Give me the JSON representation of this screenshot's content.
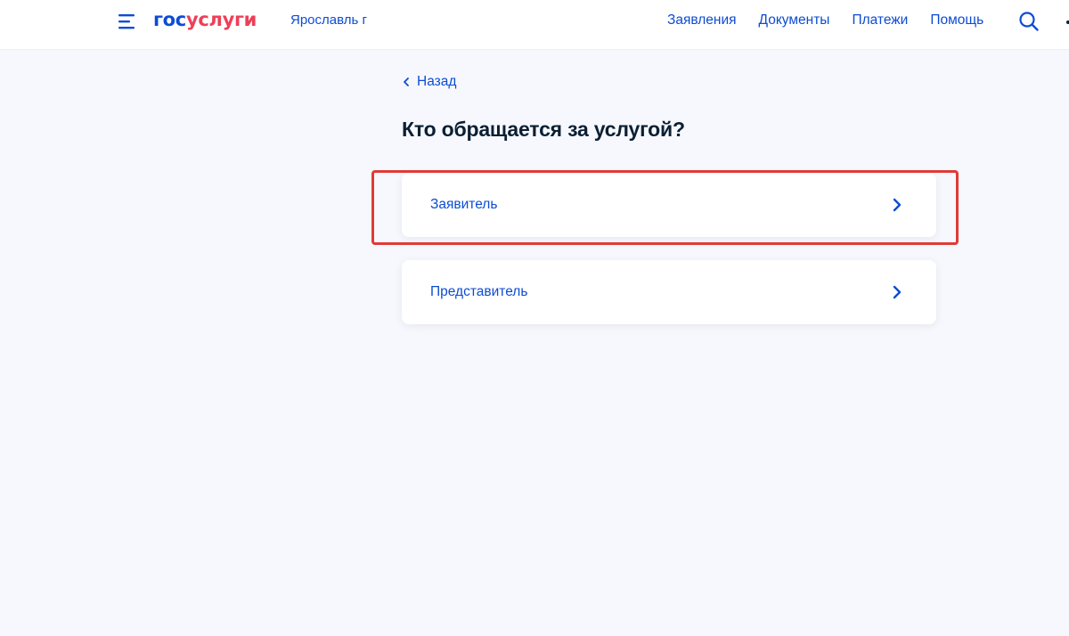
{
  "header": {
    "logo_part1": "гос",
    "logo_part2": "услуги",
    "city": "Ярославль г",
    "nav": [
      "Заявления",
      "Документы",
      "Платежи",
      "Помощь"
    ],
    "menu_icon": "burger-menu-icon",
    "search_icon": "search-icon"
  },
  "main": {
    "back_label": "Назад",
    "title": "Кто обращается за услугой?",
    "options": [
      {
        "label": "Заявитель",
        "highlighted": true
      },
      {
        "label": "Представитель",
        "highlighted": false
      }
    ]
  },
  "colors": {
    "brand_blue": "#0d4cd3",
    "brand_red": "#ee3f58",
    "page_background": "#f6f8fd",
    "highlight_border": "#e03b36",
    "text_dark": "#0b1f33"
  }
}
